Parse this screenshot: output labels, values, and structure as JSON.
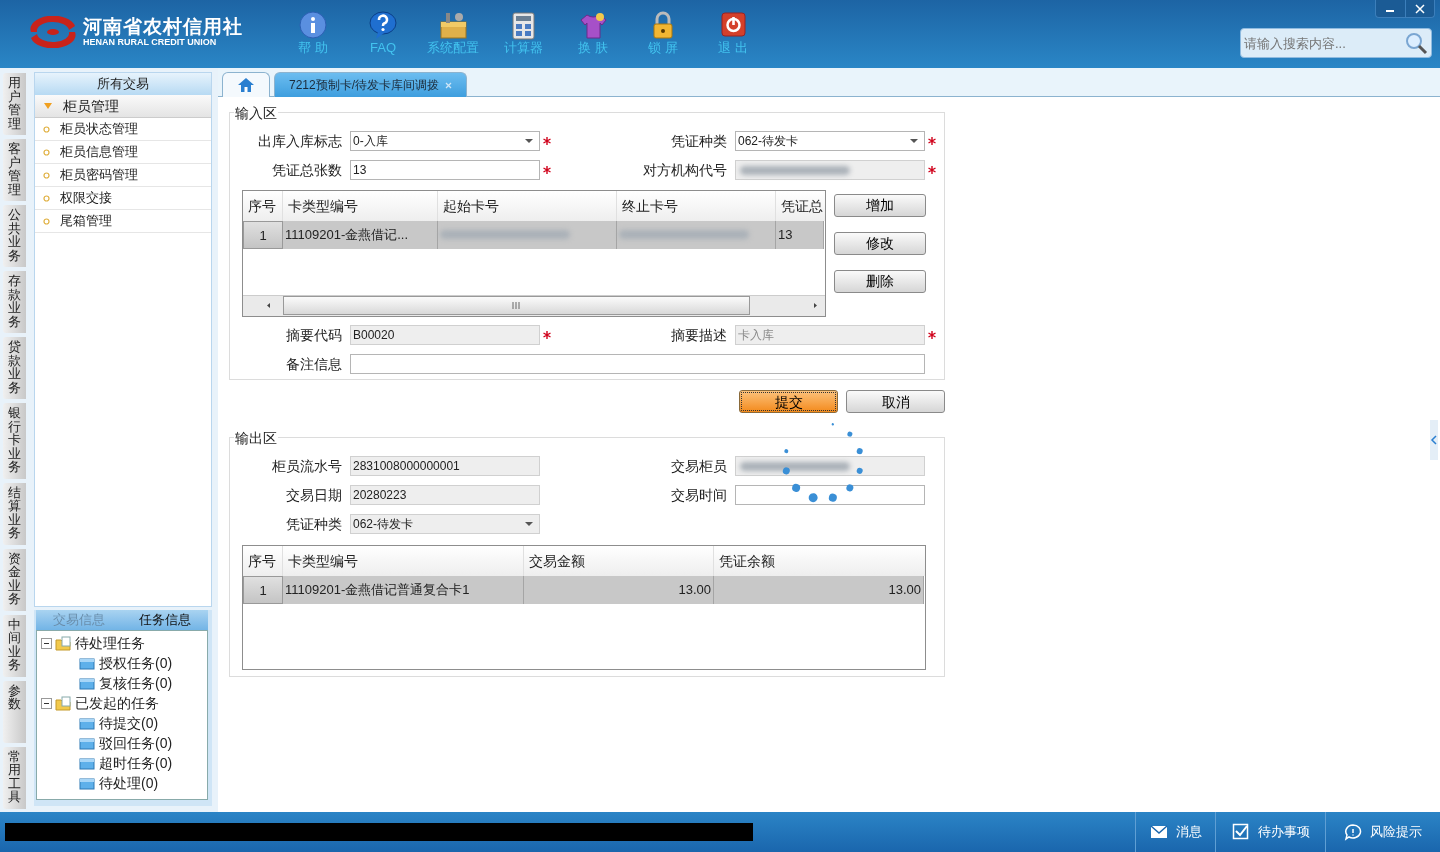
{
  "header": {
    "logo_title": "河南省农村信用社",
    "logo_subtitle": "HENAN RURAL CREDIT UNION",
    "toolbar": [
      {
        "label": "帮 助",
        "kind": "info"
      },
      {
        "label": "FAQ",
        "kind": "faq"
      },
      {
        "label": "系统配置",
        "kind": "config"
      },
      {
        "label": "计算器",
        "kind": "calculator"
      },
      {
        "label": "换 肤",
        "kind": "skin"
      },
      {
        "label": "锁 屏",
        "kind": "lock"
      },
      {
        "label": "退 出",
        "kind": "exit"
      }
    ],
    "search": {
      "placeholder": "请输入搜索内容..."
    }
  },
  "vertical_tabs": [
    {
      "label": "用户管理"
    },
    {
      "label": "客户管理"
    },
    {
      "label": "公共业务"
    },
    {
      "label": "存款业务"
    },
    {
      "label": "贷款业务"
    },
    {
      "label": "银行卡业务"
    },
    {
      "label": "结算业务"
    },
    {
      "label": "资金业务"
    },
    {
      "label": "中间业务"
    },
    {
      "label": "参数"
    },
    {
      "label": "常用工具"
    }
  ],
  "sidebar": {
    "title": "所有交易",
    "group": {
      "label": "柜员管理",
      "expanded": true,
      "items": [
        {
          "label": "柜员状态管理"
        },
        {
          "label": "柜员信息管理"
        },
        {
          "label": "柜员密码管理"
        },
        {
          "label": "权限交接"
        },
        {
          "label": "尾箱管理"
        }
      ]
    },
    "bottom_tabs": [
      {
        "label": "交易信息",
        "selected": false
      },
      {
        "label": "任务信息",
        "selected": true
      }
    ],
    "tree": [
      {
        "label": "待处理任务",
        "expanded": true,
        "children": [
          {
            "label": "授权任务(0)"
          },
          {
            "label": "复核任务(0)"
          }
        ]
      },
      {
        "label": "已发起的任务",
        "expanded": true,
        "children": [
          {
            "label": "待提交(0)"
          },
          {
            "label": "驳回任务(0)"
          },
          {
            "label": "超时任务(0)"
          },
          {
            "label": "待处理(0)"
          }
        ]
      }
    ]
  },
  "tabs": [
    {
      "kind": "home",
      "selected": false
    },
    {
      "kind": "page",
      "label": "7212预制卡/待发卡库间调拨",
      "selected": true
    }
  ],
  "input_section": {
    "title": "输入区",
    "fields": [
      {
        "label": "出库入库标志",
        "kind": "select",
        "value": "0-入库",
        "required": true,
        "disabled": false
      },
      {
        "label": "凭证种类",
        "kind": "select",
        "value": "062-待发卡",
        "required": true,
        "disabled": false
      },
      {
        "label": "凭证总张数",
        "kind": "text",
        "value": "13",
        "required": true,
        "disabled": false
      },
      {
        "label": "对方机构代号",
        "kind": "redacted",
        "required": true,
        "disabled": true
      }
    ],
    "grid": {
      "columns": [
        "序号",
        "卡类型编号",
        "起始卡号",
        "终止卡号",
        "凭证总"
      ],
      "rows": [
        {
          "selected": true,
          "cells": [
            {
              "text": "1"
            },
            {
              "text": "11109201-金燕借记..."
            },
            {
              "redacted": true
            },
            {
              "redacted": true
            },
            {
              "text": "13"
            }
          ]
        }
      ]
    },
    "grid_buttons": [
      "增加",
      "修改",
      "删除"
    ],
    "fields_after": [
      {
        "label": "摘要代码",
        "kind": "text",
        "value": "B00020",
        "required": true,
        "disabled": true
      },
      {
        "label": "摘要描述",
        "kind": "text",
        "value": "卡入库",
        "required": true,
        "disabled": true
      },
      {
        "label": "备注信息",
        "kind": "wide",
        "required": false,
        "disabled": false
      }
    ]
  },
  "actions": [
    {
      "label": "提交",
      "kind": "primary"
    },
    {
      "label": "取消",
      "kind": "default"
    }
  ],
  "output_section": {
    "title": "输出区",
    "fields": [
      {
        "label": "柜员流水号",
        "kind": "text",
        "value": "2831008000000001",
        "required": false,
        "disabled": true
      },
      {
        "label": "交易柜员",
        "kind": "redacted",
        "required": false,
        "disabled": true
      },
      {
        "label": "交易日期",
        "kind": "text",
        "value": "20280223",
        "required": false,
        "disabled": true
      },
      {
        "label": "交易时间",
        "kind": "text",
        "required": false,
        "disabled": false
      },
      {
        "label": "凭证种类",
        "kind": "select",
        "value": "062-待发卡",
        "required": false,
        "disabled": true
      }
    ],
    "grid": {
      "columns": [
        "序号",
        "卡类型编号",
        "交易金额",
        "凭证余额"
      ],
      "rows": [
        {
          "selected": true,
          "cells": [
            {
              "text": "1"
            },
            {
              "text": "11109201-金燕借记普通复合卡1"
            },
            {
              "text": "13.00",
              "kind": "amount"
            },
            {
              "text": "13.00",
              "kind": "amount"
            }
          ]
        }
      ]
    }
  },
  "loading": true,
  "status_bar": {
    "items": [
      {
        "label": "消息",
        "kind": "message"
      },
      {
        "label": "待办事项",
        "kind": "todo"
      },
      {
        "label": "风险提示",
        "kind": "risk"
      }
    ]
  }
}
